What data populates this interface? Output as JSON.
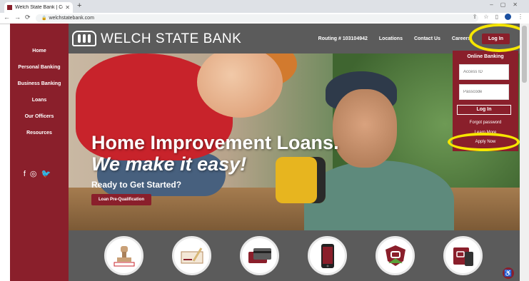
{
  "browser": {
    "tab_title": "Welch State Bank | Community I",
    "url": "welchstatebank.com"
  },
  "header": {
    "brand": "WELCH STATE BANK",
    "routing": "Routing # 103104942",
    "nav": [
      "Locations",
      "Contact Us",
      "Careers"
    ],
    "login_label": "Log In"
  },
  "sidebar": {
    "items": [
      "Home",
      "Personal Banking",
      "Business Banking",
      "Loans",
      "Our Officers",
      "Resources"
    ]
  },
  "hero": {
    "title": "Home Improvement Loans.",
    "subtitle": "We make it easy!",
    "cta_text": "Ready to Get Started?",
    "cta_button": "Loan Pre-Qualification"
  },
  "online_banking": {
    "title": "Online Banking",
    "access_id_placeholder": "Access ID",
    "passcode_placeholder": "Passcode",
    "login_button": "Log In",
    "forgot_password": "Forgot password",
    "learn_more": "Learn More",
    "apply_now": "Apply Now"
  },
  "colors": {
    "brand_red": "#8a1f2b",
    "header_gray": "#5b5b5b",
    "highlight_yellow": "#f6e600"
  },
  "service_icons": [
    "approved-stamp-icon",
    "signed-check-icon",
    "credit-cards-icon",
    "mobile-banking-icon",
    "shield-logo-icon",
    "tablet-app-icon"
  ]
}
